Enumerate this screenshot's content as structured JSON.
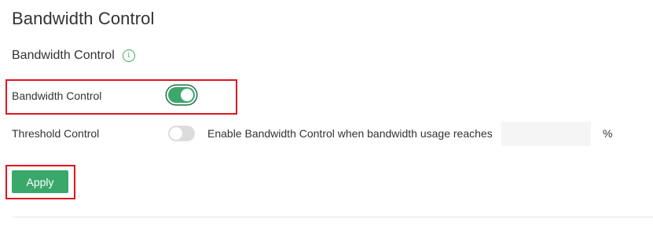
{
  "page": {
    "title": "Bandwidth Control"
  },
  "section": {
    "title": "Bandwidth Control",
    "info_icon": "info-icon"
  },
  "bandwidth_control": {
    "label": "Bandwidth Control",
    "enabled": true
  },
  "threshold_control": {
    "label": "Threshold Control",
    "enabled": false,
    "description": "Enable Bandwidth Control when bandwidth usage reaches",
    "value": "",
    "unit": "%"
  },
  "actions": {
    "apply_label": "Apply"
  },
  "colors": {
    "accent": "#3aa86b",
    "highlight": "#e0141e",
    "toggle_off": "#dcdcdc"
  }
}
